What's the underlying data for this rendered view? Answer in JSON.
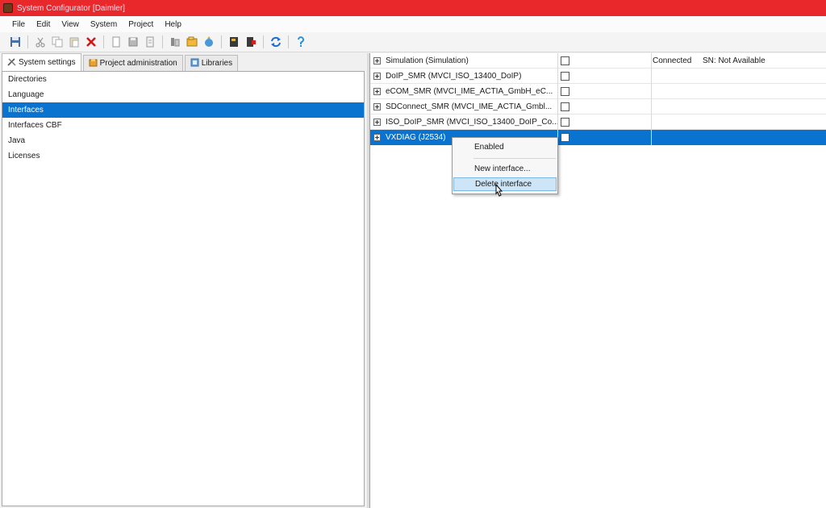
{
  "window": {
    "title": "System Configurator [Daimler]"
  },
  "menu": [
    "File",
    "Edit",
    "View",
    "System",
    "Project",
    "Help"
  ],
  "toolbar": {
    "icons": [
      "save-icon",
      "cut-icon",
      "copy-icon",
      "paste-icon",
      "delete-icon",
      "new-doc-icon",
      "save-doc-icon",
      "doc-icon",
      "settings-icon",
      "database-icon",
      "export-icon",
      "book-icon",
      "flag-icon",
      "refresh-icon",
      "help-icon"
    ],
    "colors": {
      "delete": "#d01818",
      "refresh": "#1a6fd0",
      "help": "#2b8fd8"
    }
  },
  "tabs": [
    {
      "label": "System settings",
      "icon": "tools-icon",
      "active": true
    },
    {
      "label": "Project administration",
      "icon": "project-icon",
      "active": false
    },
    {
      "label": "Libraries",
      "icon": "library-icon",
      "active": false
    }
  ],
  "settings": [
    {
      "label": "Directories",
      "selected": false
    },
    {
      "label": "Language",
      "selected": false
    },
    {
      "label": "Interfaces",
      "selected": true
    },
    {
      "label": "Interfaces CBF",
      "selected": false
    },
    {
      "label": "Java",
      "selected": false
    },
    {
      "label": "Licenses",
      "selected": false
    }
  ],
  "interfaces": [
    {
      "name": "Simulation (Simulation)",
      "enabled": false,
      "status": "Connected",
      "serial": "SN: Not Available",
      "selected": false
    },
    {
      "name": "DoIP_SMR (MVCI_ISO_13400_DoIP)",
      "enabled": false,
      "status": "",
      "serial": "",
      "selected": false
    },
    {
      "name": "eCOM_SMR (MVCI_IME_ACTIA_GmbH_eC...",
      "enabled": false,
      "status": "",
      "serial": "",
      "selected": false
    },
    {
      "name": "SDConnect_SMR (MVCI_IME_ACTIA_Gmbl...",
      "enabled": false,
      "status": "",
      "serial": "",
      "selected": false
    },
    {
      "name": "ISO_DoIP_SMR (MVCI_ISO_13400_DoIP_Co...",
      "enabled": false,
      "status": "",
      "serial": "",
      "selected": false
    },
    {
      "name": "VXDIAG (J2534)",
      "enabled": false,
      "status": "",
      "serial": "",
      "selected": true
    }
  ],
  "context_menu": {
    "enabled_label": "Enabled",
    "new_label": "New interface...",
    "delete_label": "Delete interface"
  },
  "accent": "#0a73d0",
  "titlebar_color": "#e8282a"
}
